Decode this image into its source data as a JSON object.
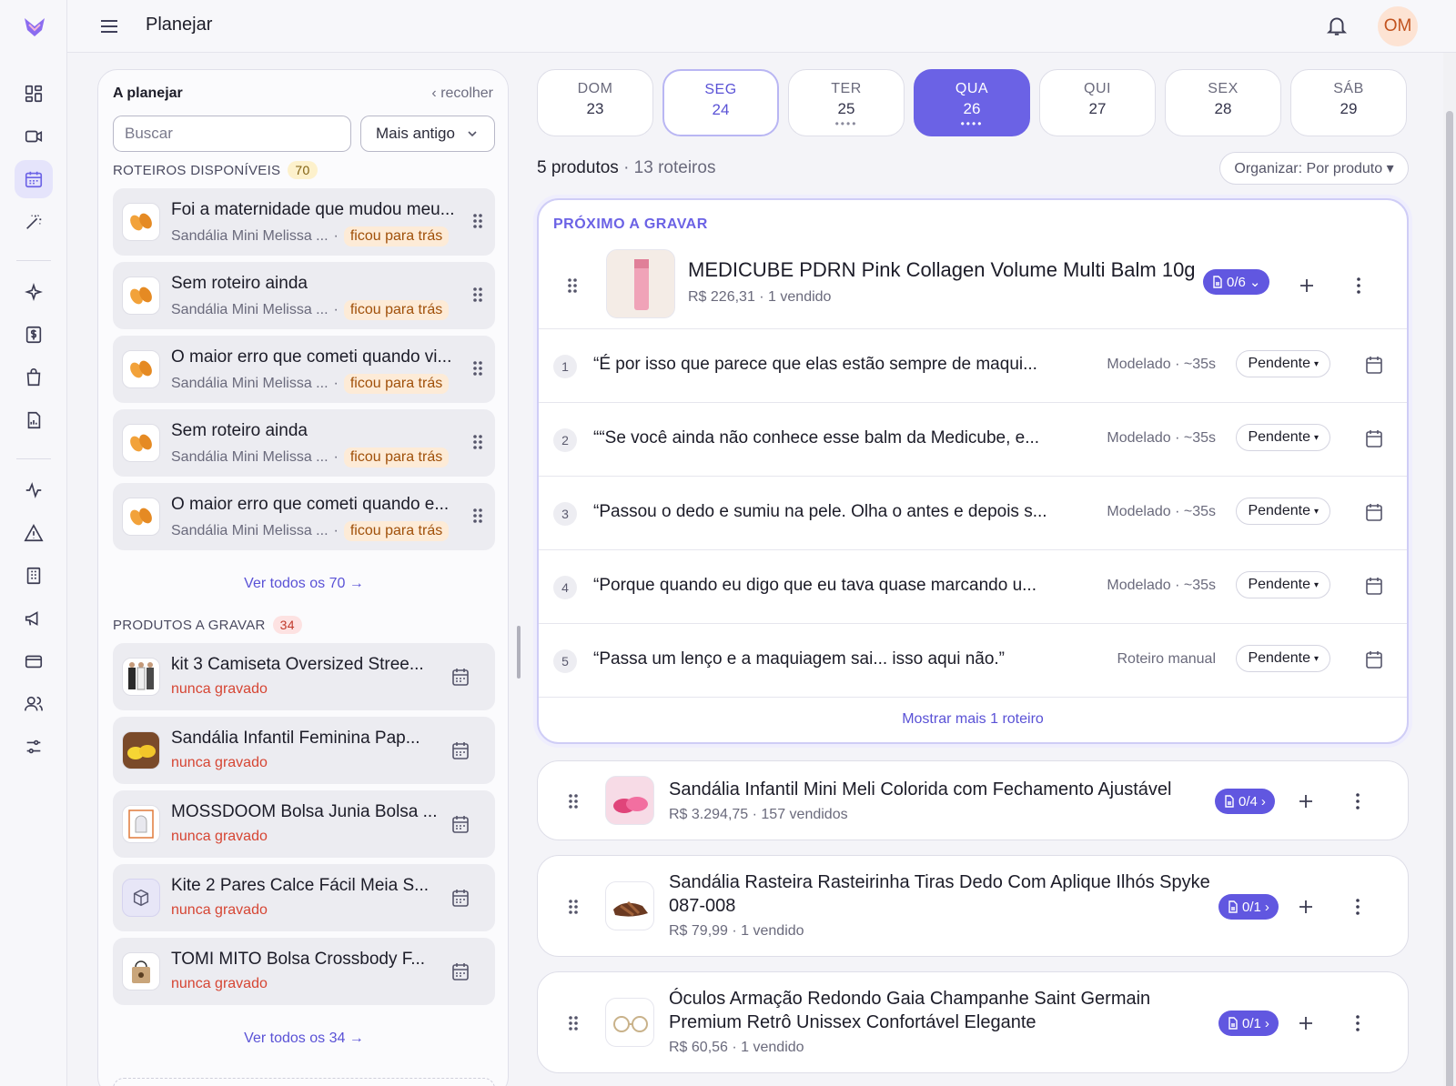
{
  "header": {
    "title": "Planejar",
    "avatar_initials": "OM"
  },
  "rail": {
    "icons": [
      "logo-icon",
      "dashboard-icon",
      "video-icon",
      "calendar-icon",
      "magic-wand-icon",
      "sparkles-icon",
      "dollar-icon",
      "shopping-bag-icon",
      "report-icon",
      "activity-icon",
      "alert-icon",
      "building-icon",
      "megaphone-icon",
      "card-icon",
      "users-icon",
      "sliders-icon"
    ],
    "active": "calendar-icon"
  },
  "left_panel": {
    "title": "A planejar",
    "collapse_label": "‹ recolher",
    "search_placeholder": "Buscar",
    "sort_value": "Mais antigo",
    "scripts_section": {
      "label": "ROTEIROS DISPONÍVEIS",
      "count": "70"
    },
    "scripts": [
      {
        "title": "Foi a maternidade que mudou meu...",
        "product": "Sandália Mini Melissa ...",
        "sep": "·",
        "tag": "ficou para trás"
      },
      {
        "title": "Sem roteiro ainda",
        "product": "Sandália Mini Melissa ...",
        "sep": "·",
        "tag": "ficou para trás"
      },
      {
        "title": "O maior erro que cometi quando vi...",
        "product": "Sandália Mini Melissa ...",
        "sep": "·",
        "tag": "ficou para trás"
      },
      {
        "title": "Sem roteiro ainda",
        "product": "Sandália Mini Melissa ...",
        "sep": "·",
        "tag": "ficou para trás"
      },
      {
        "title": "O maior erro que cometi quando e...",
        "product": "Sandália Mini Melissa ...",
        "sep": "·",
        "tag": "ficou para trás"
      }
    ],
    "scripts_see_all": "Ver todos os 70 →",
    "products_section": {
      "label": "PRODUTOS A GRAVAR",
      "count": "34"
    },
    "products": [
      {
        "title": "kit 3 Camiseta Oversized Stree...",
        "status": "nunca gravado"
      },
      {
        "title": "Sandália Infantil Feminina Pap...",
        "status": "nunca gravado"
      },
      {
        "title": "MOSSDOOM Bolsa Junia Bolsa ...",
        "status": "nunca gravado"
      },
      {
        "title": "Kite 2 Pares Calce Fácil Meia S...",
        "status": "nunca gravado"
      },
      {
        "title": "TOMI MITO Bolsa Crossbody F...",
        "status": "nunca gravado"
      }
    ],
    "products_see_all": "Ver todos os 34 →"
  },
  "days": [
    {
      "name": "DOM",
      "date": "23",
      "dots": ""
    },
    {
      "name": "SEG",
      "date": "24",
      "dots": "",
      "today": true
    },
    {
      "name": "TER",
      "date": "25",
      "dots": "••••"
    },
    {
      "name": "QUA",
      "date": "26",
      "dots": "••••",
      "selected": true
    },
    {
      "name": "QUI",
      "date": "27",
      "dots": ""
    },
    {
      "name": "SEX",
      "date": "28",
      "dots": ""
    },
    {
      "name": "SÁB",
      "date": "29",
      "dots": ""
    }
  ],
  "summary": {
    "products": "5 produtos",
    "scripts": " · 13 roteiros"
  },
  "organize_label": "Organizar: Por produto ▾",
  "next_label": "PRÓXIMO A GRAVAR",
  "featured": {
    "title": "MEDICUBE PDRN Pink Collagen Volume Multi Balm 10g",
    "meta": "R$ 226,31 · 1 vendido",
    "scripts_pill": "0/6",
    "scripts": [
      {
        "num": "1",
        "quote": "“É por isso que parece que elas estão sempre de maqui...",
        "mode": "Modelado · ~35s",
        "status": "Pendente"
      },
      {
        "num": "2",
        "quote": "““Se você ainda não conhece esse balm da Medicube, e...",
        "mode": "Modelado · ~35s",
        "status": "Pendente"
      },
      {
        "num": "3",
        "quote": "“Passou o dedo e sumiu na pele. Olha o antes e depois s...",
        "mode": "Modelado · ~35s",
        "status": "Pendente"
      },
      {
        "num": "4",
        "quote": "“Porque quando eu digo que eu tava quase marcando u...",
        "mode": "Modelado · ~35s",
        "status": "Pendente"
      },
      {
        "num": "5",
        "quote": "“Passa um lenço e a maquiagem sai... isso aqui não.”",
        "mode": "Roteiro manual",
        "status": "Pendente"
      }
    ],
    "show_more": "Mostrar mais 1 roteiro"
  },
  "other_products": [
    {
      "title_l1": "Sandália Infantil Mini Meli Colorida com Fechamento Ajustável",
      "title_l2": "",
      "meta": "R$ 3.294,75 · 157 vendidos",
      "pill": "0/4"
    },
    {
      "title_l1": "Sandália Rasteira Rasteirinha Tiras Dedo Com Aplique Ilhós Spyke",
      "title_l2": "087-008",
      "meta": "R$ 79,99 · 1 vendido",
      "pill": "0/1"
    },
    {
      "title_l1": "Óculos Armação Redondo Gaia Champanhe Saint Germain",
      "title_l2": "Premium Retrô Unissex Confortável Elegante",
      "meta": "R$ 60,56 · 1 vendido",
      "pill": "0/1"
    }
  ],
  "colors": {
    "accent": "#6b62e5",
    "tag_bg": "#fdebd7",
    "never_recorded": "#d64533"
  }
}
